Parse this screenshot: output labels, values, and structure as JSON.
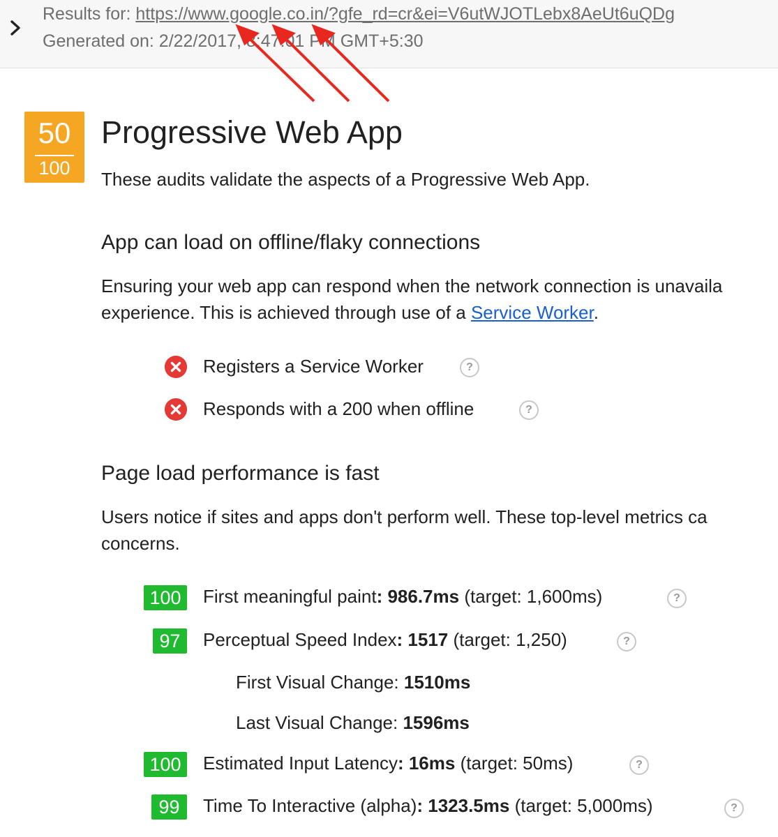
{
  "header": {
    "results_prefix": "Results for: ",
    "url": "https://www.google.co.in/?gfe_rd=cr&ei=V6utWJOTLebx8AeUt6uQDg",
    "generated": "Generated on: 2/22/2017, 8:47:01 PM GMT+5:30",
    "chevron_icon": "chevron-right-icon"
  },
  "category": {
    "score": "50",
    "score_max": "100",
    "score_color": "#f5a623",
    "title": "Progressive Web App",
    "description": "These audits validate the aspects of a Progressive Web App."
  },
  "sections": {
    "offline": {
      "heading": "App can load on offline/flaky connections",
      "desc_line1": "Ensuring your web app can respond when the network connection is unavaila",
      "desc_line2_prefix": "experience. This is achieved through use of a ",
      "desc_link": "Service Worker",
      "desc_line2_suffix": ".",
      "audits": [
        {
          "status": "fail",
          "label": "Registers a Service Worker"
        },
        {
          "status": "fail",
          "label": "Responds with a 200 when offline"
        }
      ]
    },
    "performance": {
      "heading": "Page load performance is fast",
      "desc_line1": "Users notice if sites and apps don't perform well. These top-level metrics ca",
      "desc_line2": "concerns.",
      "audits": [
        {
          "score": "100",
          "name": "First meaningful paint",
          "value": ": 986.7ms",
          "target": " (target: 1,600ms)"
        },
        {
          "score": "97",
          "name": "Perceptual Speed Index",
          "value": ": 1517",
          "target": " (target: 1,250)"
        },
        {
          "score": "100",
          "name": "Estimated Input Latency",
          "value": ": 16ms",
          "target": " (target: 50ms)"
        },
        {
          "score": "99",
          "name": "Time To Interactive (alpha)",
          "value": ": 1323.5ms",
          "target": " (target: 5,000ms)"
        }
      ],
      "sub_metrics": [
        {
          "label": "First Visual Change: ",
          "value": "1510ms"
        },
        {
          "label": "Last Visual Change: ",
          "value": "1596ms"
        }
      ]
    }
  },
  "colors": {
    "pass": "#1fba2f",
    "fail": "#e53935",
    "link": "#1a5fd0",
    "arrow": "#e8281e"
  },
  "help_glyph": "?"
}
